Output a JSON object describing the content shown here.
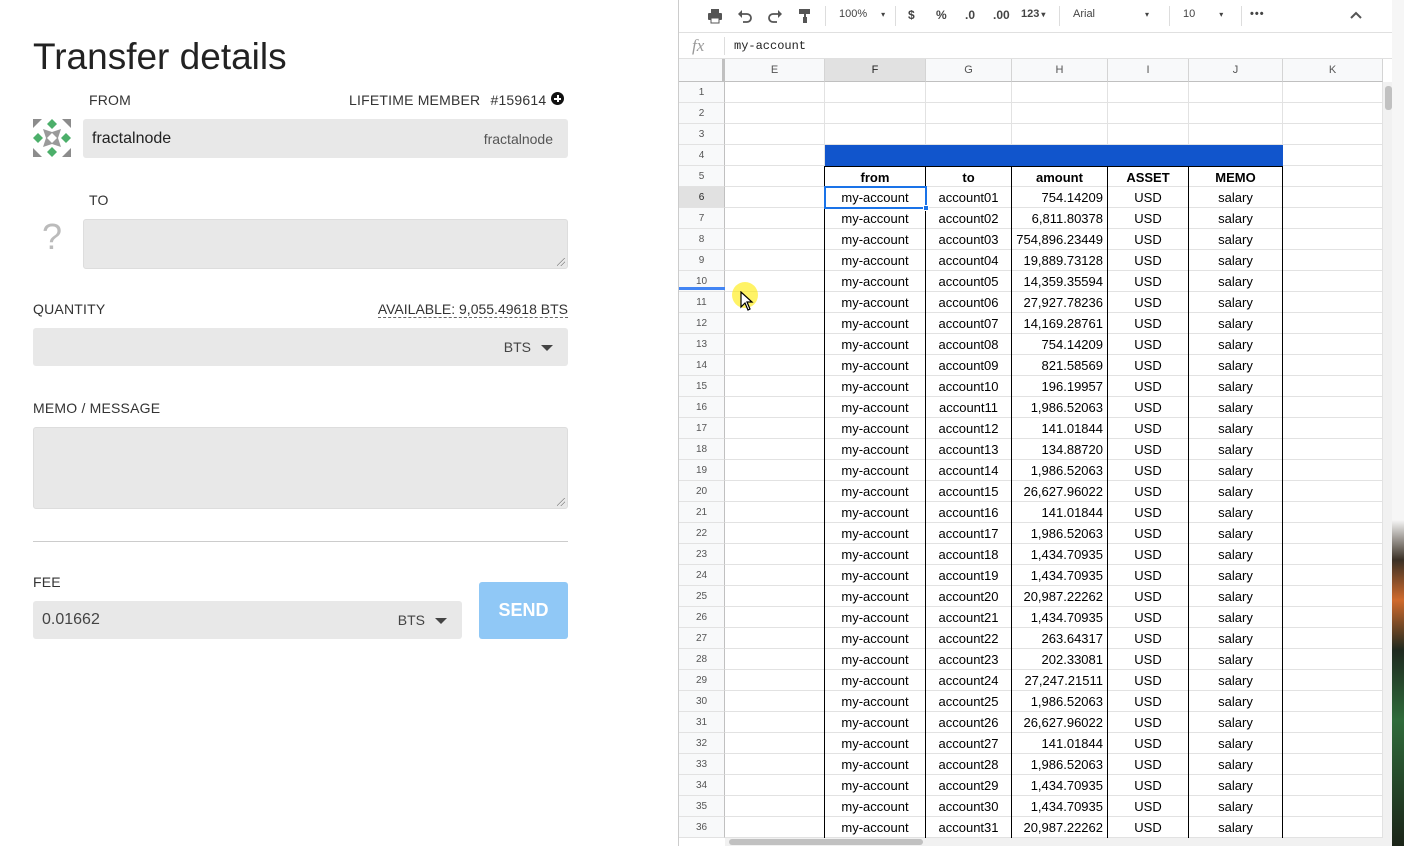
{
  "transfer": {
    "title": "Transfer details",
    "from_label": "FROM",
    "membership": "LIFETIME MEMBER",
    "member_id": "#159614",
    "from_value": "fractalnode",
    "from_account_tag": "fractalnode",
    "to_label": "TO",
    "to_value": "",
    "quantity_label": "QUANTITY",
    "available": "AVAILABLE: 9,055.49618 BTS",
    "quantity_value": "",
    "quantity_asset": "BTS",
    "memo_label": "MEMO / MESSAGE",
    "memo_value": "",
    "fee_label": "FEE",
    "fee_value": "0.01662",
    "fee_asset": "BTS",
    "send_label": "SEND",
    "send_color": "#90c8f6"
  },
  "spreadsheet": {
    "toolbar": {
      "zoom": "100%",
      "currency": "$",
      "percent": "%",
      "dec_less": ".0",
      "dec_more": ".00",
      "number_format": "123",
      "font": "Arial",
      "font_size": "10",
      "more": "•••"
    },
    "formula_bar": {
      "fx": "fx",
      "value": "my-account"
    },
    "columns": [
      "E",
      "F",
      "G",
      "H",
      "I",
      "J",
      "K"
    ],
    "selected_column": "F",
    "header_row": [
      "from",
      "to",
      "amount",
      "ASSET",
      "MEMO"
    ],
    "accent_color": "#1155cc",
    "row_numbers": [
      "1",
      "2",
      "3",
      "4",
      "5",
      "6",
      "7",
      "8",
      "9",
      "10",
      "11",
      "12",
      "13",
      "14",
      "15",
      "16",
      "17",
      "18",
      "19",
      "20",
      "21",
      "22",
      "23",
      "24",
      "25",
      "26",
      "27",
      "28",
      "29",
      "30",
      "31",
      "32",
      "33",
      "34",
      "35",
      "36"
    ],
    "rows": [
      [
        "my-account",
        "account01",
        "754.14209",
        "USD",
        "salary"
      ],
      [
        "my-account",
        "account02",
        "6,811.80378",
        "USD",
        "salary"
      ],
      [
        "my-account",
        "account03",
        "754,896.23449",
        "USD",
        "salary"
      ],
      [
        "my-account",
        "account04",
        "19,889.73128",
        "USD",
        "salary"
      ],
      [
        "my-account",
        "account05",
        "14,359.35594",
        "USD",
        "salary"
      ],
      [
        "my-account",
        "account06",
        "27,927.78236",
        "USD",
        "salary"
      ],
      [
        "my-account",
        "account07",
        "14,169.28761",
        "USD",
        "salary"
      ],
      [
        "my-account",
        "account08",
        "754.14209",
        "USD",
        "salary"
      ],
      [
        "my-account",
        "account09",
        "821.58569",
        "USD",
        "salary"
      ],
      [
        "my-account",
        "account10",
        "196.19957",
        "USD",
        "salary"
      ],
      [
        "my-account",
        "account11",
        "1,986.52063",
        "USD",
        "salary"
      ],
      [
        "my-account",
        "account12",
        "141.01844",
        "USD",
        "salary"
      ],
      [
        "my-account",
        "account13",
        "134.88720",
        "USD",
        "salary"
      ],
      [
        "my-account",
        "account14",
        "1,986.52063",
        "USD",
        "salary"
      ],
      [
        "my-account",
        "account15",
        "26,627.96022",
        "USD",
        "salary"
      ],
      [
        "my-account",
        "account16",
        "141.01844",
        "USD",
        "salary"
      ],
      [
        "my-account",
        "account17",
        "1,986.52063",
        "USD",
        "salary"
      ],
      [
        "my-account",
        "account18",
        "1,434.70935",
        "USD",
        "salary"
      ],
      [
        "my-account",
        "account19",
        "1,434.70935",
        "USD",
        "salary"
      ],
      [
        "my-account",
        "account20",
        "20,987.22262",
        "USD",
        "salary"
      ],
      [
        "my-account",
        "account21",
        "1,434.70935",
        "USD",
        "salary"
      ],
      [
        "my-account",
        "account22",
        "263.64317",
        "USD",
        "salary"
      ],
      [
        "my-account",
        "account23",
        "202.33081",
        "USD",
        "salary"
      ],
      [
        "my-account",
        "account24",
        "27,247.21511",
        "USD",
        "salary"
      ],
      [
        "my-account",
        "account25",
        "1,986.52063",
        "USD",
        "salary"
      ],
      [
        "my-account",
        "account26",
        "26,627.96022",
        "USD",
        "salary"
      ],
      [
        "my-account",
        "account27",
        "141.01844",
        "USD",
        "salary"
      ],
      [
        "my-account",
        "account28",
        "1,986.52063",
        "USD",
        "salary"
      ],
      [
        "my-account",
        "account29",
        "1,434.70935",
        "USD",
        "salary"
      ],
      [
        "my-account",
        "account30",
        "1,434.70935",
        "USD",
        "salary"
      ],
      [
        "my-account",
        "account31",
        "20,987.22262",
        "USD",
        "salary"
      ]
    ]
  }
}
